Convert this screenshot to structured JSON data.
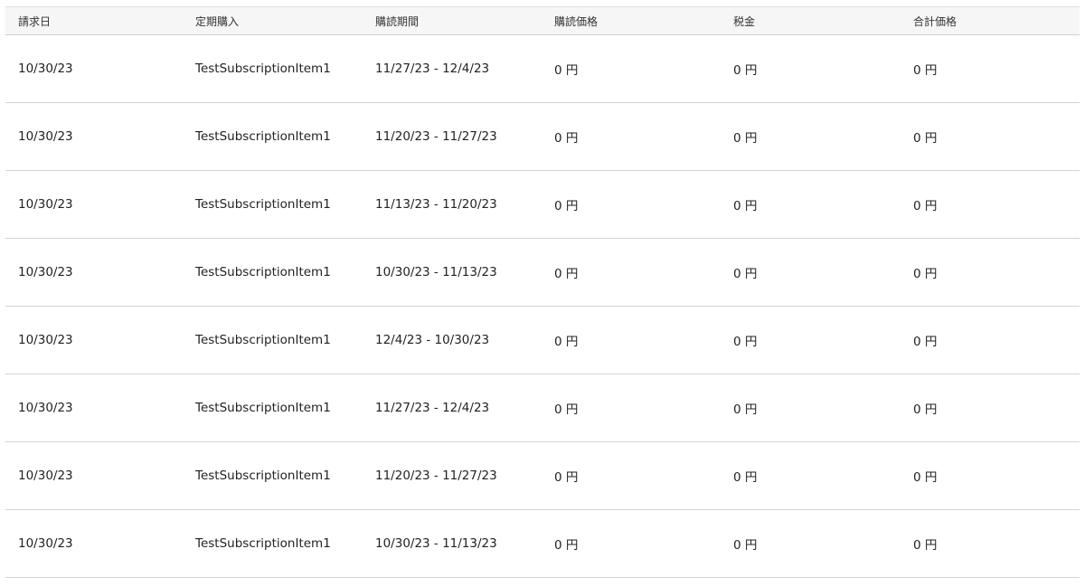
{
  "table": {
    "headers": [
      "請求日",
      "定期購入",
      "購読期間",
      "購読価格",
      "税金",
      "合計価格"
    ],
    "rows": [
      [
        "10/30/23",
        "TestSubscriptionItem1",
        "11/27/23 - 12/4/23",
        "0 円",
        "0 円",
        "0 円"
      ],
      [
        "10/30/23",
        "TestSubscriptionItem1",
        "11/20/23 - 11/27/23",
        "0 円",
        "0 円",
        "0 円"
      ],
      [
        "10/30/23",
        "TestSubscriptionItem1",
        "11/13/23 - 11/20/23",
        "0 円",
        "0 円",
        "0 円"
      ],
      [
        "10/30/23",
        "TestSubscriptionItem1",
        "10/30/23 - 11/13/23",
        "0 円",
        "0 円",
        "0 円"
      ],
      [
        "10/30/23",
        "TestSubscriptionItem1",
        "12/4/23 - 10/30/23",
        "0 円",
        "0 円",
        "0 円"
      ],
      [
        "10/30/23",
        "TestSubscriptionItem1",
        "11/27/23 - 12/4/23",
        "0 円",
        "0 円",
        "0 円"
      ],
      [
        "10/30/23",
        "TestSubscriptionItem1",
        "11/20/23 - 11/27/23",
        "0 円",
        "0 円",
        "0 円"
      ],
      [
        "10/30/23",
        "TestSubscriptionItem1",
        "10/30/23 - 11/13/23",
        "0 円",
        "0 円",
        "0 円"
      ]
    ]
  }
}
